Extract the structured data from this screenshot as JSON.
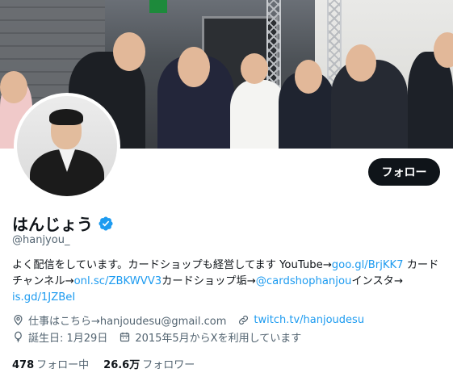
{
  "profile": {
    "display_name": "はんじょう",
    "handle": "@hanjyou_",
    "follow_label": "フォロー",
    "verified": true
  },
  "bio": {
    "text1": "よく配信をしています。カードショップも経営してます YouTube→",
    "link1": "goo.gl/BrjKK7",
    "text2": " カードチャンネル→",
    "link2": "onl.sc/ZBKWVV3",
    "text3": "カードショップ垢→",
    "link3": "@cardshophanjou",
    "text4": "インスタ→ ",
    "link4": "is.gd/1JZBeI"
  },
  "meta": {
    "location": "仕事はこちら→hanjoudesu@gmail.com",
    "website": "twitch.tv/hanjoudesu",
    "birthday": "誕生日: 1月29日",
    "joined": "2015年5月からXを利用しています"
  },
  "stats": {
    "following_count": "478",
    "following_label": "フォロー中",
    "followers_count": "26.6万",
    "followers_label": "フォロワー"
  },
  "colors": {
    "accent": "#1d9bf0",
    "text": "#0f1419",
    "secondary": "#536471",
    "button": "#0f1419"
  },
  "icons": {
    "verified": "verified-badge-icon",
    "location": "location-pin-icon",
    "link": "link-icon",
    "birthday": "balloon-icon",
    "calendar": "calendar-icon"
  }
}
